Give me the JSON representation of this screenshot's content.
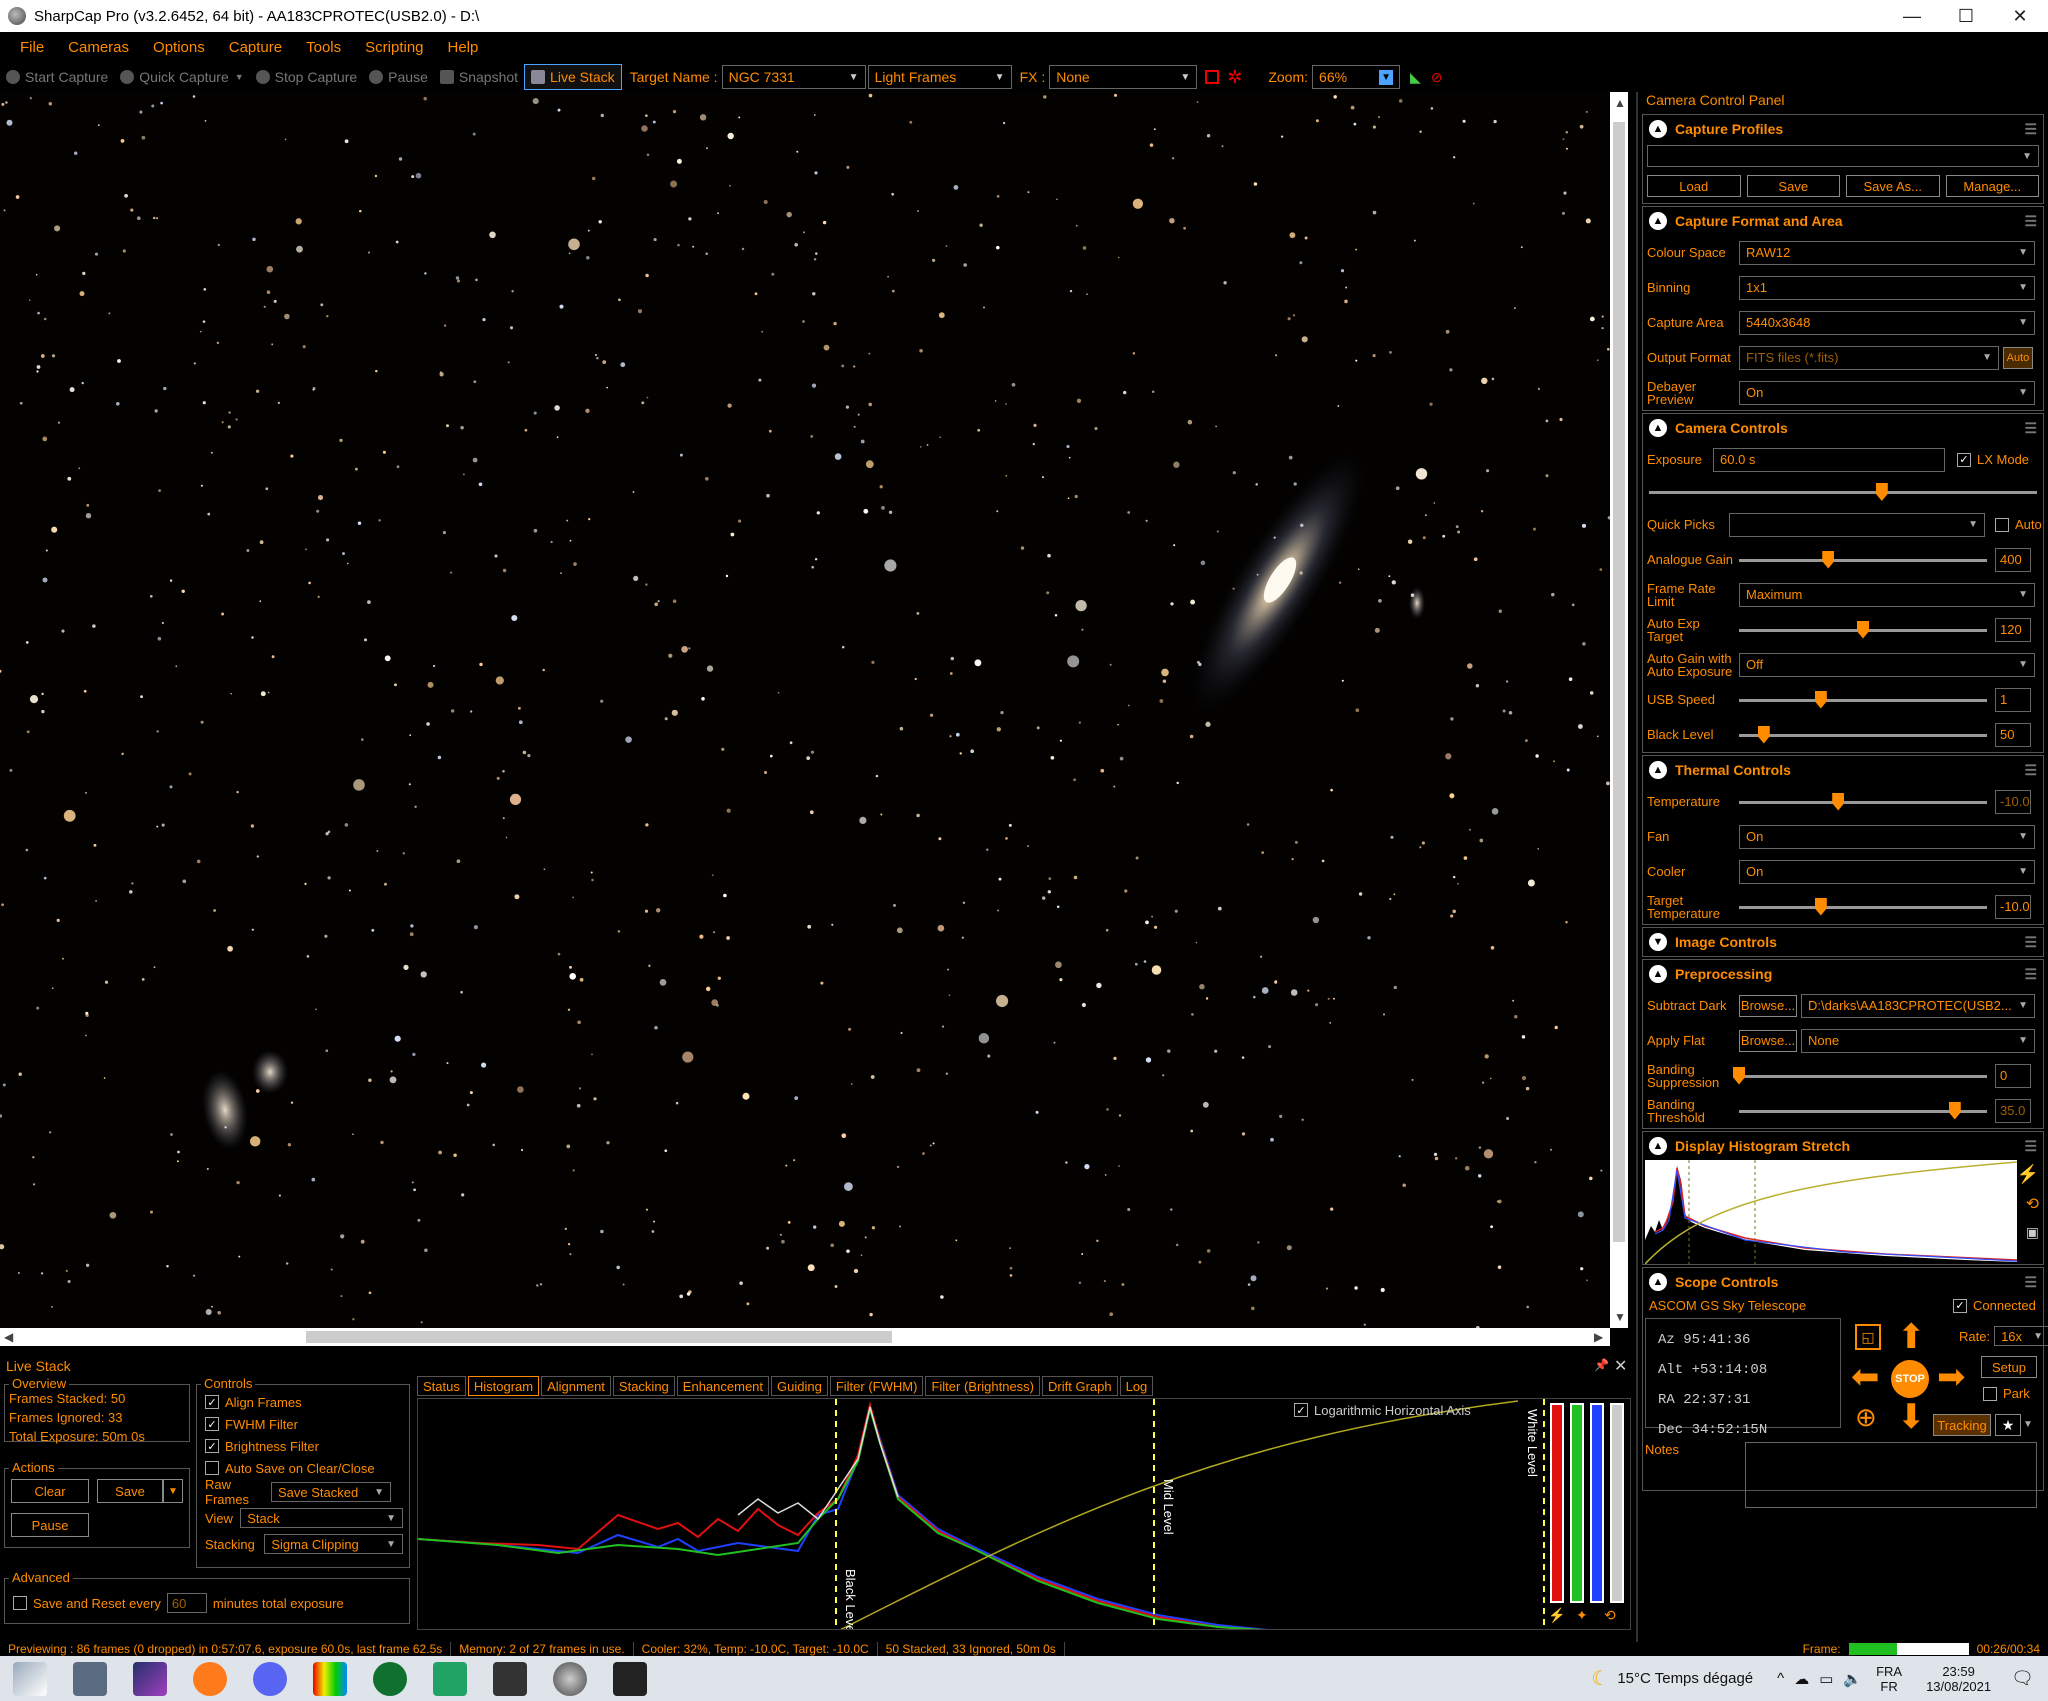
{
  "window": {
    "title": "SharpCap Pro (v3.2.6452, 64 bit) - AA183CPROTEC(USB2.0) - D:\\",
    "minimize": "—",
    "maximize": "☐",
    "close": "✕"
  },
  "menu": [
    "File",
    "Cameras",
    "Options",
    "Capture",
    "Tools",
    "Scripting",
    "Help"
  ],
  "toolbar": {
    "start_capture": "Start Capture",
    "quick_capture": "Quick Capture",
    "stop_capture": "Stop Capture",
    "pause": "Pause",
    "snapshot": "Snapshot",
    "live_stack": "Live Stack",
    "target_name_label": "Target Name :",
    "target_name": "NGC 7331",
    "frame_type": "Light Frames",
    "fx_label": "FX :",
    "fx_value": "None",
    "zoom_label": "Zoom:",
    "zoom_value": "66%"
  },
  "panel": {
    "title": "Camera Control Panel",
    "capture_profiles": {
      "title": "Capture Profiles",
      "profile": "",
      "load": "Load",
      "save": "Save",
      "save_as": "Save As...",
      "manage": "Manage..."
    },
    "capture_format": {
      "title": "Capture Format and Area",
      "colour_space_label": "Colour Space",
      "colour_space": "RAW12",
      "binning_label": "Binning",
      "binning": "1x1",
      "capture_area_label": "Capture Area",
      "capture_area": "5440x3648",
      "output_format_label": "Output Format",
      "output_format": "FITS files (*.fits)",
      "auto": "Auto",
      "debayer_label": "Debayer Preview",
      "debayer": "On"
    },
    "camera_controls": {
      "title": "Camera Controls",
      "exposure_label": "Exposure",
      "exposure": "60.0 s",
      "lx_mode": "LX Mode",
      "exposure_slider": 0.6,
      "quick_picks_label": "Quick Picks",
      "quick_picks_auto": "Auto",
      "analogue_gain_label": "Analogue Gain",
      "analogue_gain": "400",
      "analogue_gain_slider": 0.36,
      "frame_rate_label": "Frame Rate Limit",
      "frame_rate": "Maximum",
      "auto_exp_target_label": "Auto Exp Target",
      "auto_exp_target": "120",
      "auto_exp_slider": 0.5,
      "auto_gain_label": "Auto Gain with Auto Exposure",
      "auto_gain": "Off",
      "usb_speed_label": "USB Speed",
      "usb_speed": "1",
      "usb_speed_slider": 0.33,
      "black_level_label": "Black Level",
      "black_level": "50",
      "black_level_slider": 0.1
    },
    "thermal": {
      "title": "Thermal Controls",
      "temperature_label": "Temperature",
      "temperature": "-10.0",
      "temperature_slider": 0.4,
      "fan_label": "Fan",
      "fan": "On",
      "cooler_label": "Cooler",
      "cooler": "On",
      "target_temp_label": "Target Temperature",
      "target_temp": "-10.0",
      "target_temp_slider": 0.33
    },
    "image_controls": {
      "title": "Image Controls"
    },
    "preprocessing": {
      "title": "Preprocessing",
      "subtract_dark_label": "Subtract Dark",
      "browse": "Browse...",
      "subtract_dark": "D:\\darks\\AA183CPROTEC(USB2...",
      "apply_flat_label": "Apply Flat",
      "apply_flat": "None",
      "banding_suppression_label": "Banding Suppression",
      "banding_suppression": "0",
      "banding_suppression_slider": 0.0,
      "banding_threshold_label": "Banding Threshold",
      "banding_threshold": "35.0",
      "banding_threshold_slider": 0.87
    },
    "display_stretch": {
      "title": "Display Histogram Stretch"
    },
    "scope": {
      "title": "Scope Controls",
      "telescope": "ASCOM GS Sky Telescope",
      "connected": "Connected",
      "az": "Az  95:41:36",
      "alt": "Alt +53:14:08",
      "ra": "RA  22:37:31",
      "dec": "Dec 34:52:15N",
      "rate_label": "Rate:",
      "rate": "16x",
      "setup": "Setup",
      "park": "Park",
      "tracking": "Tracking",
      "stop": "STOP",
      "notes_label": "Notes"
    }
  },
  "livestack": {
    "title": "Live Stack",
    "overview_title": "Overview",
    "frames_stacked": "Frames Stacked: 50",
    "frames_ignored": "Frames Ignored:  33",
    "total_exposure": "Total Exposure:  50m 0s",
    "actions_title": "Actions",
    "clear": "Clear",
    "save": "Save",
    "pause": "Pause",
    "advanced_title": "Advanced",
    "save_reset_label": "Save and Reset every",
    "save_reset_minutes": "60",
    "save_reset_suffix": "minutes total exposure",
    "controls_title": "Controls",
    "align_frames": "Align Frames",
    "fwhm_filter": "FWHM Filter",
    "brightness_filter": "Brightness Filter",
    "auto_save": "Auto Save on Clear/Close",
    "raw_frames_label": "Raw Frames",
    "raw_frames": "Save Stacked",
    "view_label": "View",
    "view": "Stack",
    "stacking_label": "Stacking",
    "stacking": "Sigma Clipping",
    "tabs": [
      "Status",
      "Histogram",
      "Alignment",
      "Stacking",
      "Enhancement",
      "Guiding",
      "Filter (FWHM)",
      "Filter (Brightness)",
      "Drift Graph",
      "Log"
    ],
    "log_axis": "Logarithmic Horizontal Axis",
    "black_level": "Black Level",
    "mid_level": "Mid Level",
    "white_level": "White Level"
  },
  "status": {
    "previewing": "Previewing : 86 frames (0 dropped) in 0:57:07.6, exposure 60.0s, last frame 62.5s",
    "memory": "Memory: 2 of 27 frames in use.",
    "cooler": "Cooler: 32%, Temp: -10.0C, Target: -10.0C",
    "stacked": "50 Stacked, 33 Ignored, 50m 0s",
    "frame_label": "Frame:",
    "elapsed": "00:26/00:34"
  },
  "taskbar": {
    "weather": "15°C  Temps dégagé",
    "lang1": "FRA",
    "lang2": "FR",
    "time": "23:59",
    "date": "13/08/2021"
  },
  "colors": {
    "accent": "#ff8c00",
    "background": "#000000",
    "red_channel": "#e01010",
    "green_channel": "#20c020",
    "blue_channel": "#2040ff"
  }
}
